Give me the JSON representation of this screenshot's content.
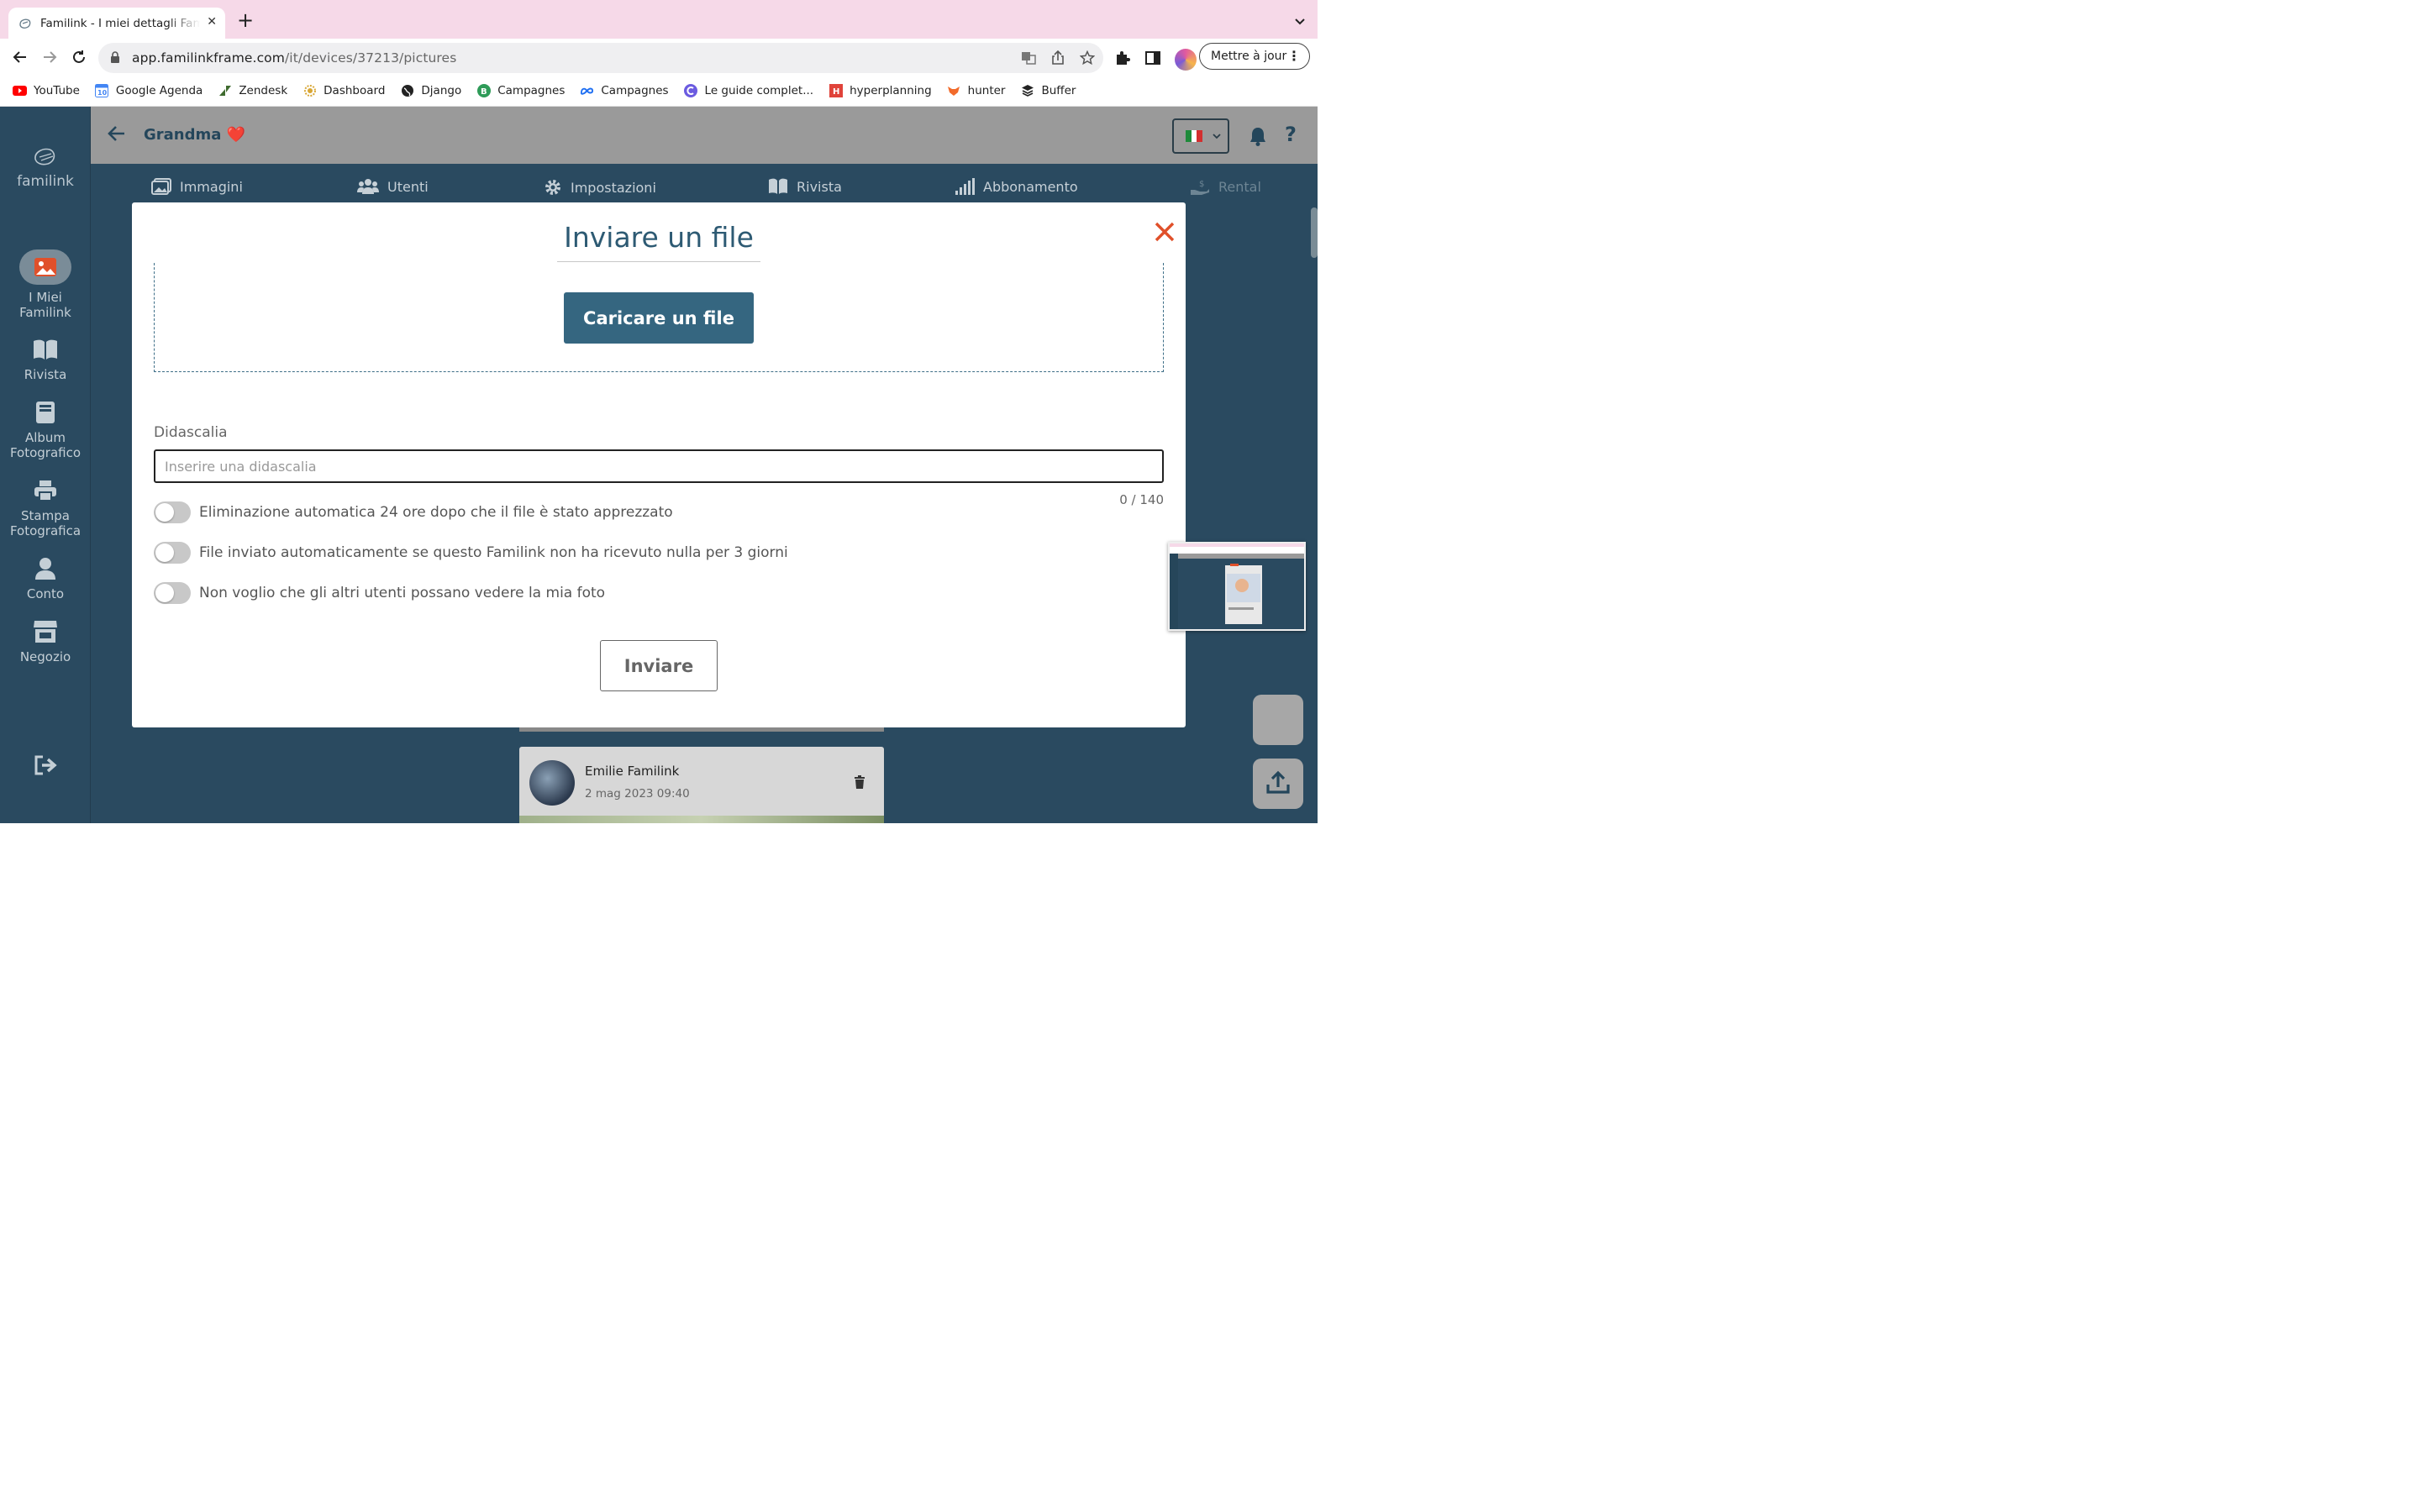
{
  "browser": {
    "tab_title": "Familink - I miei dettagli Familink",
    "url_host": "app.familinkframe.com",
    "url_path": "/it/devices/37213/pictures",
    "update_label": "Mettre à jour",
    "bookmarks": [
      {
        "label": "YouTube",
        "icon": "youtube-icon",
        "color": "#ff0000"
      },
      {
        "label": "Google Agenda",
        "icon": "calendar-icon",
        "color": "#4285f4"
      },
      {
        "label": "Zendesk",
        "icon": "zendesk-icon",
        "color": "#3f6b2f"
      },
      {
        "label": "Dashboard",
        "icon": "dashboard-icon",
        "color": "#d8a634"
      },
      {
        "label": "Django",
        "icon": "globe-icon",
        "color": "#222222"
      },
      {
        "label": "Campagnes",
        "icon": "b-icon",
        "color": "#2e9b58"
      },
      {
        "label": "Campagnes",
        "icon": "meta-icon",
        "color": "#1f6ff2"
      },
      {
        "label": "Le guide complet...",
        "icon": "c-icon",
        "color": "#6b5be0"
      },
      {
        "label": "hyperplanning",
        "icon": "h-icon",
        "color": "#e0433a"
      },
      {
        "label": "hunter",
        "icon": "fox-icon",
        "color": "#f26b2b"
      },
      {
        "label": "Buffer",
        "icon": "buffer-icon",
        "color": "#222222"
      }
    ]
  },
  "sidebar": {
    "logo": "familink",
    "items": [
      {
        "label": "I Miei\nFamilink",
        "icon": "image-icon"
      },
      {
        "label": "Rivista",
        "icon": "book-icon"
      },
      {
        "label": "Album\nFotografico",
        "icon": "album-icon"
      },
      {
        "label": "Stampa\nFotografica",
        "icon": "printer-icon"
      },
      {
        "label": "Conto",
        "icon": "user-icon"
      },
      {
        "label": "Negozio",
        "icon": "store-icon"
      }
    ]
  },
  "header": {
    "title": "Grandma ❤️"
  },
  "tabs": [
    {
      "label": "Immagini",
      "icon": "images-icon"
    },
    {
      "label": "Utenti",
      "icon": "users-icon"
    },
    {
      "label": "Impostazioni",
      "icon": "gear-icon"
    },
    {
      "label": "Rivista",
      "icon": "book-icon"
    },
    {
      "label": "Abbonamento",
      "icon": "signal-icon"
    },
    {
      "label": "Rental",
      "icon": "rental-icon"
    }
  ],
  "modal": {
    "title": "Inviare un file",
    "upload_button": "Caricare un file",
    "caption_label": "Didascalia",
    "caption_placeholder": "Inserire una didascalia",
    "caption_value": "",
    "counter": "0 / 140",
    "toggles": [
      {
        "label": "Eliminazione automatica 24 ore dopo che il file è stato apprezzato",
        "on": false
      },
      {
        "label": "File inviato automaticamente se questo Familink non ha ricevuto nulla per 3 giorni",
        "on": false
      },
      {
        "label": "Non voglio che gli altri utenti possano vedere la mia foto",
        "on": false
      }
    ],
    "send_button": "Inviare"
  },
  "background_card": {
    "name": "Emilie Familink",
    "date": "2 mag 2023 09:40"
  },
  "colors": {
    "primary": "#356680",
    "title": "#2d5a73",
    "close": "#e0502a",
    "app_bg": "#2a4a60",
    "tab_strip": "#f6d9e8"
  }
}
